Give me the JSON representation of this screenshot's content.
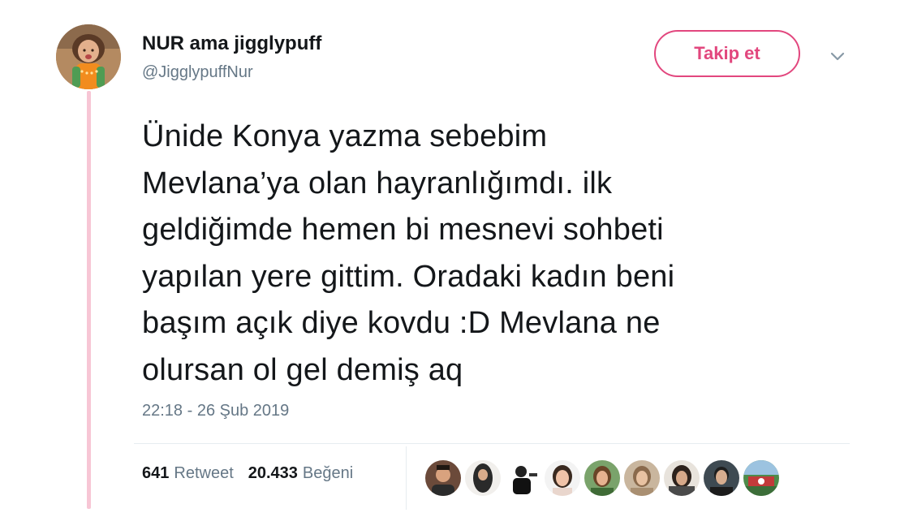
{
  "tweet": {
    "display_name": "NUR ama jigglypuff",
    "handle": "@JigglypuffNur",
    "follow_label": "Takip et",
    "text": "Ünide Konya yazma sebebim\nMevlana’ya  olan hayranlığımdı. ilk\ngeldiğimde hemen bi mesnevi sohbeti\nyapılan yere gittim. Oradaki kadın beni\nbaşım açık diye kovdu :D Mevlana ne\nolursan ol gel demiş aq",
    "timestamp": "22:18 - 26 Şub 2019"
  },
  "stats": {
    "retweets_count": "641",
    "retweets_label": "Retweet",
    "likes_count": "20.433",
    "likes_label": "Beğeni"
  },
  "colors": {
    "accent_pink": "#e2477e",
    "thread_line": "#f7c6d5",
    "secondary_text": "#657786"
  },
  "likers": [
    {
      "icon": "liker-avatar-1"
    },
    {
      "icon": "liker-avatar-2"
    },
    {
      "icon": "liker-avatar-3"
    },
    {
      "icon": "liker-avatar-4"
    },
    {
      "icon": "liker-avatar-5"
    },
    {
      "icon": "liker-avatar-6"
    },
    {
      "icon": "liker-avatar-7"
    },
    {
      "icon": "liker-avatar-8"
    },
    {
      "icon": "liker-avatar-9"
    }
  ]
}
